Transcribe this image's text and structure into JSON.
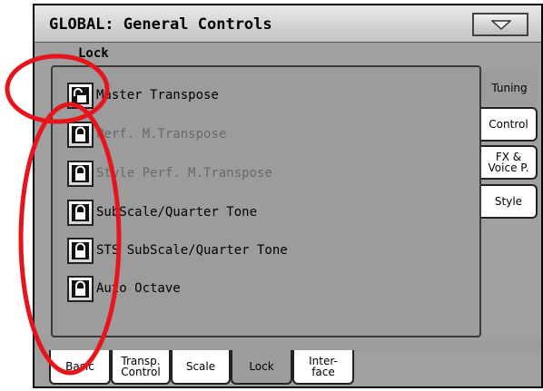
{
  "header": {
    "title": "GLOBAL: General Controls",
    "menu_icon": "triangle-down-icon"
  },
  "section": {
    "label": "Lock"
  },
  "locks": [
    {
      "label": "Master Transpose",
      "state": "unlocked",
      "enabled": true
    },
    {
      "label": "Perf. M.Transpose",
      "state": "locked",
      "enabled": false
    },
    {
      "label": "Style Perf. M.Transpose",
      "state": "locked",
      "enabled": false
    },
    {
      "label": "SubScale/Quarter Tone",
      "state": "locked",
      "enabled": true
    },
    {
      "label": "STS SubScale/Quarter Tone",
      "state": "locked",
      "enabled": true
    },
    {
      "label": "Auto Octave",
      "state": "locked",
      "enabled": true
    }
  ],
  "side_tabs": [
    {
      "label": "Tuning",
      "active": true
    },
    {
      "label": "Control",
      "active": false
    },
    {
      "label": "FX & Voice P.",
      "line1": "FX &",
      "line2": "Voice P.",
      "active": false
    },
    {
      "label": "Style",
      "active": false
    }
  ],
  "bottom_tabs": [
    {
      "label": "Basic",
      "active": false
    },
    {
      "label": "Transp. Control",
      "line1": "Transp.",
      "line2": "Control",
      "active": false
    },
    {
      "label": "Scale",
      "active": false
    },
    {
      "label": "Lock",
      "active": true
    },
    {
      "label": "Inter- face",
      "line1": "Inter-",
      "line2": "face",
      "active": false
    }
  ],
  "colors": {
    "annotation": "#e8141c",
    "panel": "#9c9c9c",
    "tab_inactive": "#ffffff"
  }
}
